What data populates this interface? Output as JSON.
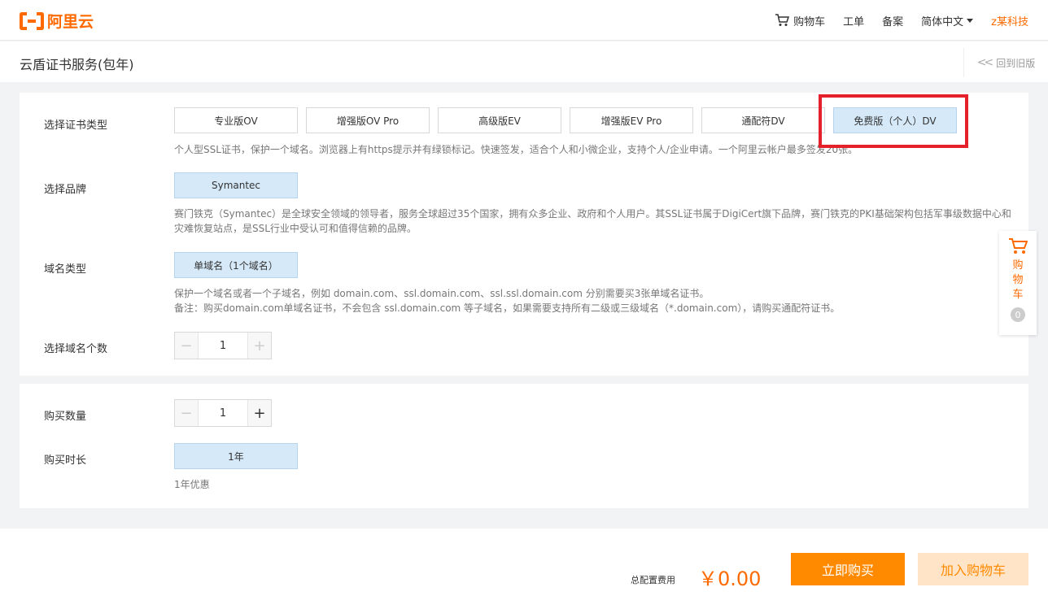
{
  "header": {
    "logo_text": "阿里云",
    "nav": [
      {
        "label": "购物车",
        "icon": "cart-icon"
      },
      {
        "label": "工单"
      },
      {
        "label": "备案"
      },
      {
        "label": "简体中文"
      },
      {
        "label": "z某科技"
      }
    ]
  },
  "title_bar": {
    "title": "云盾证书服务(包年)",
    "back_label": "回到旧版"
  },
  "cert_type": {
    "label": "选择证书类型",
    "options": [
      "专业版OV",
      "增强版OV Pro",
      "高级版EV",
      "增强版EV Pro",
      "通配符DV",
      "免费版（个人）DV"
    ],
    "selected": "免费版（个人）DV",
    "description": "个人型SSL证书，保护一个域名。浏览器上有https提示并有绿锁标记。快速签发，适合个人和小微企业，支持个人/企业申请。一个阿里云帐户最多签发20张。"
  },
  "brand": {
    "label": "选择品牌",
    "option": "Symantec",
    "description_line1": "赛门铁克（Symantec）是全球安全领域的领导者，服务全球超过35个国家，拥有众多企业、政府和个人用户。其SSL证书属于DigiCert旗下品牌，赛门铁克的PKI基础架构包括军事级数据中心和",
    "description_line2": "灾难恢复站点，是SSL行业中受认可和值得信赖的品牌。"
  },
  "domain_type": {
    "label": "域名类型",
    "option": "单域名（1个域名）",
    "description_line1": "保护一个域名或者一个子域名，例如 domain.com、ssl.domain.com、ssl.ssl.domain.com 分别需要买3张单域名证书。",
    "description_line2": "备注：购买domain.com单域名证书，不会包含 ssl.domain.com 等子域名，如果需要支持所有二级或三级域名（*.domain.com），请购买通配符证书。"
  },
  "domain_count": {
    "label": "选择域名个数",
    "value": "1",
    "minus": "−",
    "plus": "+"
  },
  "purchase": {
    "qty_label": "购买数量",
    "qty_value": "1",
    "minus": "−",
    "plus": "+",
    "duration_label": "购买时长",
    "duration_option": "1年",
    "duration_note": "1年优惠"
  },
  "side_cart": {
    "label": "购物车",
    "count": "0"
  },
  "footer": {
    "total_label": "总配置费用",
    "total_price": "￥0.00",
    "buy_label": "立即购买",
    "add_cart_label": "加入购物车"
  },
  "colors": {
    "brand": "#ff6a00",
    "selected_bg": "#d6e9f8",
    "highlight": "#e4202a"
  }
}
